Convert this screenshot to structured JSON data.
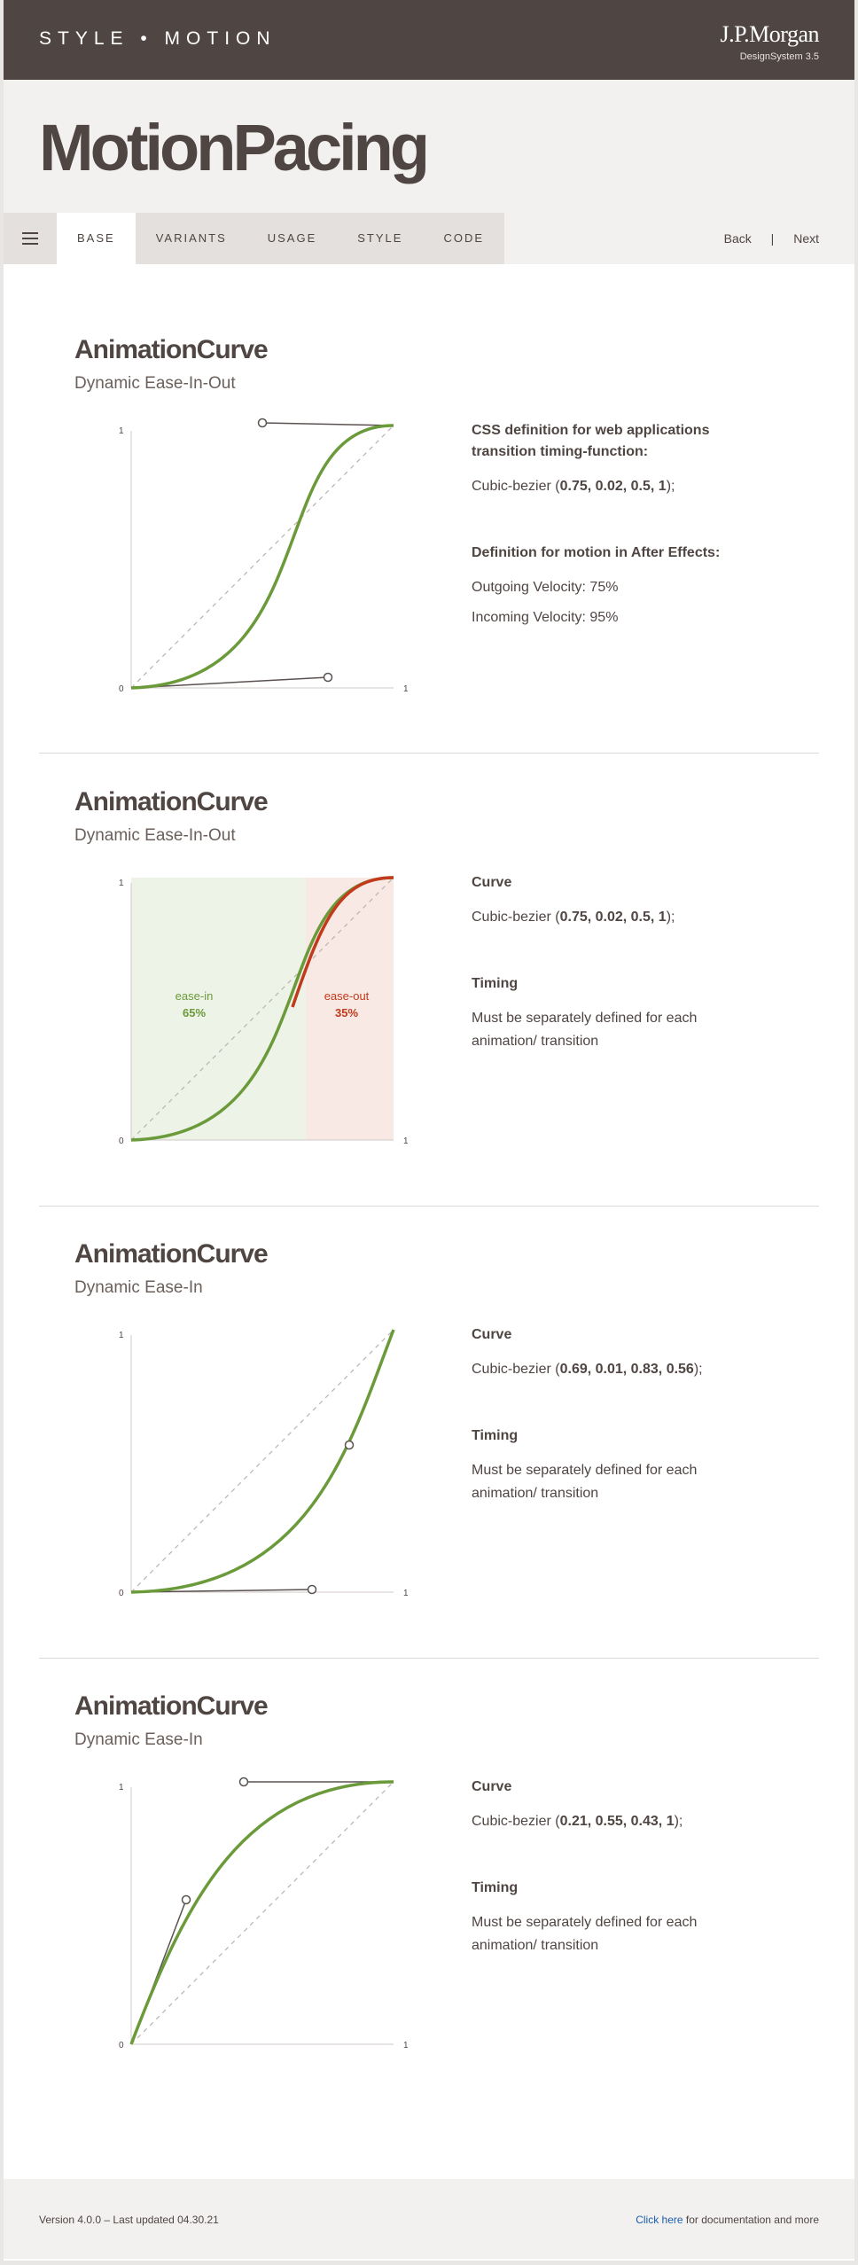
{
  "header": {
    "breadcrumb": "STYLE  •  MOTION",
    "brand": "J.P.Morgan",
    "design_system": "DesignSystem  3.5"
  },
  "hero": {
    "title": "MotionPacing"
  },
  "tabs": [
    "BASE",
    "VARIANTS",
    "USAGE",
    "STYLE",
    "CODE"
  ],
  "pager": {
    "back": "Back",
    "separator": "|",
    "next": "Next"
  },
  "axis": {
    "zero": "0",
    "one": "1"
  },
  "sections": [
    {
      "title": "AnimationCurve",
      "subtitle": "Dynamic Ease-In-Out",
      "h1": "CSS definition for web applications transition timing-function:",
      "p1_prefix": "Cubic-bezier (",
      "p1_values": "0.75, 0.02, 0.5, 1",
      "p1_suffix": ");",
      "h2": "Definition for motion in After Effects:",
      "p2": "Outgoing Velocity: 75%",
      "p3": "Incoming Velocity: 95%"
    },
    {
      "title": "AnimationCurve",
      "subtitle": "Dynamic Ease-In-Out",
      "h1": "Curve",
      "p1_prefix": "Cubic-bezier (",
      "p1_values": "0.75, 0.02, 0.5, 1",
      "p1_suffix": ");",
      "h2": "Timing",
      "p2": "Must be separately defined for each animation/ transition",
      "ease_in_label": "ease-in",
      "ease_in_value": "65%",
      "ease_out_label": "ease-out",
      "ease_out_value": "35%"
    },
    {
      "title": "AnimationCurve",
      "subtitle": "Dynamic Ease-In",
      "h1": "Curve",
      "p1_prefix": "Cubic-bezier (",
      "p1_values": "0.69, 0.01, 0.83, 0.56",
      "p1_suffix": ");",
      "h2": "Timing",
      "p2": "Must be separately defined for each animation/ transition"
    },
    {
      "title": "AnimationCurve",
      "subtitle": "Dynamic Ease-In",
      "h1": "Curve",
      "p1_prefix": "Cubic-bezier (",
      "p1_values": "0.21, 0.55, 0.43, 1",
      "p1_suffix": ");",
      "h2": "Timing",
      "p2": "Must be separately defined for each animation/ transition"
    }
  ],
  "footer": {
    "version": "Version 4.0.0 – Last updated 04.30.21",
    "link_text": "Click here",
    "link_suffix": " for documentation and more"
  },
  "colors": {
    "header_bg": "#4f4542",
    "curve_green": "#6a9a3a",
    "curve_red": "#c2391b",
    "ease_in_zone": "#eef3e8",
    "ease_out_zone": "#f8e9e5",
    "link_blue": "#1a5ea8"
  },
  "icons": [
    "hamburger-menu-icon"
  ]
}
